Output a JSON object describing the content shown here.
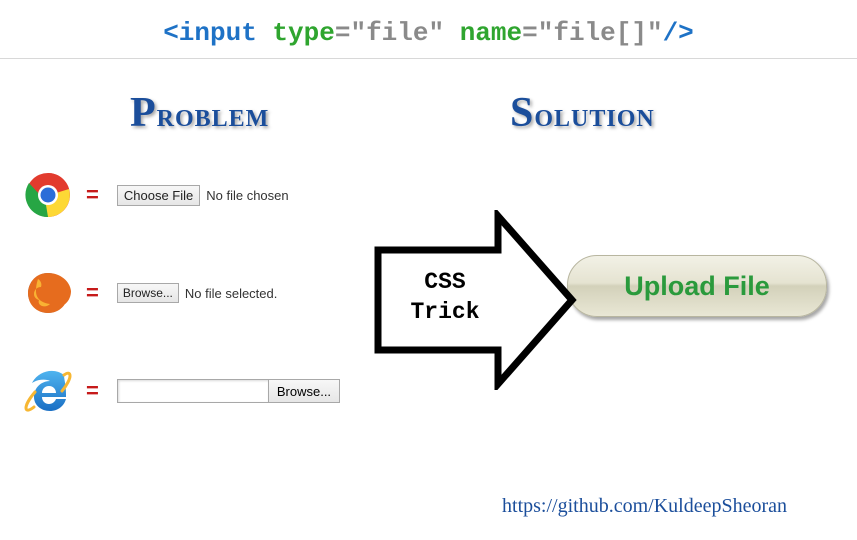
{
  "code": {
    "open_bracket": "<",
    "tag": "input",
    "attr1_name": "type",
    "eq": "=",
    "quote": "\"",
    "attr1_val": "file",
    "attr2_name": "name",
    "attr2_val": "file[]",
    "close": "/>"
  },
  "headings": {
    "problem_first": "P",
    "problem_rest": "roblem",
    "solution_first": "S",
    "solution_rest": "olution"
  },
  "rows": {
    "chrome": {
      "button": "Choose File",
      "status": "No file chosen"
    },
    "firefox": {
      "button": "Browse...",
      "status": "No file selected."
    },
    "ie": {
      "button": "Browse..."
    }
  },
  "equals_symbol": "=",
  "arrow_label_line1": "CSS",
  "arrow_label_line2": "Trick",
  "upload_button": "Upload File",
  "credit": "https://github.com/KuldeepSheoran"
}
